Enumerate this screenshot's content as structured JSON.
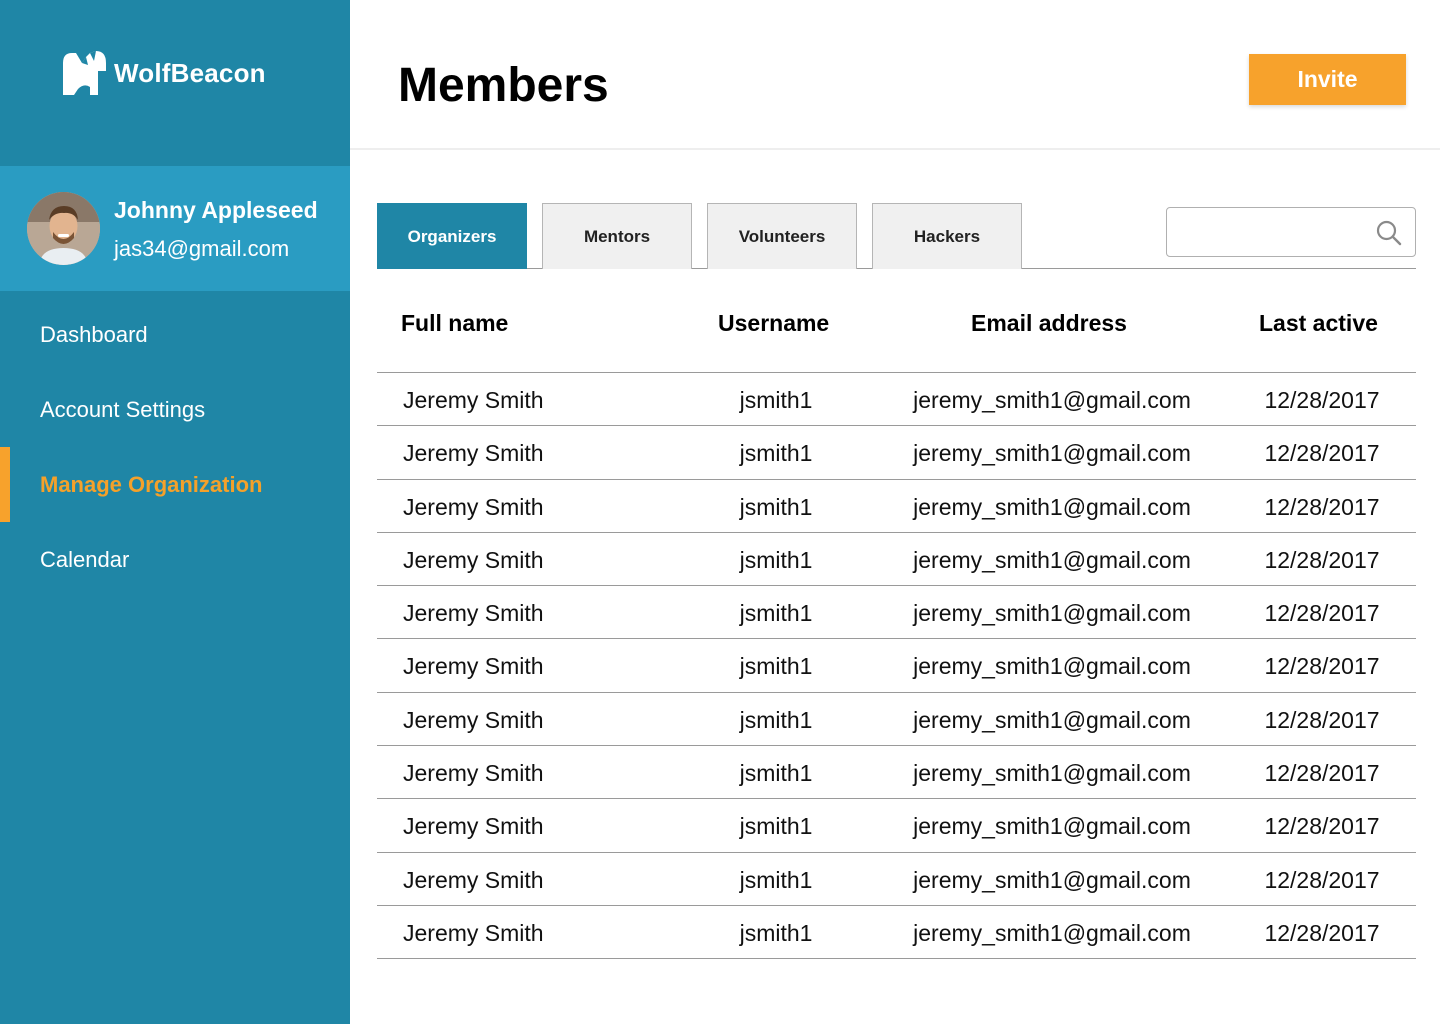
{
  "app": {
    "logo_text": "WolfBeacon"
  },
  "profile": {
    "name": "Johnny Appleseed",
    "email": "jas34@gmail.com"
  },
  "nav": {
    "items": [
      {
        "label": "Dashboard"
      },
      {
        "label": "Account Settings"
      },
      {
        "label": "Manage Organization",
        "active": true
      },
      {
        "label": "Calendar"
      }
    ]
  },
  "header": {
    "title": "Members",
    "invite_label": "Invite"
  },
  "tabs": [
    {
      "label": "Organizers",
      "active": true
    },
    {
      "label": "Mentors"
    },
    {
      "label": "Volunteers"
    },
    {
      "label": "Hackers"
    }
  ],
  "search": {
    "placeholder": "",
    "icon": "search-icon"
  },
  "table": {
    "columns": [
      "Full name",
      "Username",
      "Email address",
      "Last active"
    ],
    "rows": [
      [
        "Jeremy Smith",
        "jsmith1",
        "jeremy_smith1@gmail.com",
        "12/28/2017"
      ],
      [
        "Jeremy Smith",
        "jsmith1",
        "jeremy_smith1@gmail.com",
        "12/28/2017"
      ],
      [
        "Jeremy Smith",
        "jsmith1",
        "jeremy_smith1@gmail.com",
        "12/28/2017"
      ],
      [
        "Jeremy Smith",
        "jsmith1",
        "jeremy_smith1@gmail.com",
        "12/28/2017"
      ],
      [
        "Jeremy Smith",
        "jsmith1",
        "jeremy_smith1@gmail.com",
        "12/28/2017"
      ],
      [
        "Jeremy Smith",
        "jsmith1",
        "jeremy_smith1@gmail.com",
        "12/28/2017"
      ],
      [
        "Jeremy Smith",
        "jsmith1",
        "jeremy_smith1@gmail.com",
        "12/28/2017"
      ],
      [
        "Jeremy Smith",
        "jsmith1",
        "jeremy_smith1@gmail.com",
        "12/28/2017"
      ],
      [
        "Jeremy Smith",
        "jsmith1",
        "jeremy_smith1@gmail.com",
        "12/28/2017"
      ],
      [
        "Jeremy Smith",
        "jsmith1",
        "jeremy_smith1@gmail.com",
        "12/28/2017"
      ],
      [
        "Jeremy Smith",
        "jsmith1",
        "jeremy_smith1@gmail.com",
        "12/28/2017"
      ]
    ]
  },
  "colors": {
    "sidebar": "#1f86a6",
    "profile_bg": "#2a9cc2",
    "accent": "#f7a22c",
    "active_tab": "#1f86a6"
  }
}
